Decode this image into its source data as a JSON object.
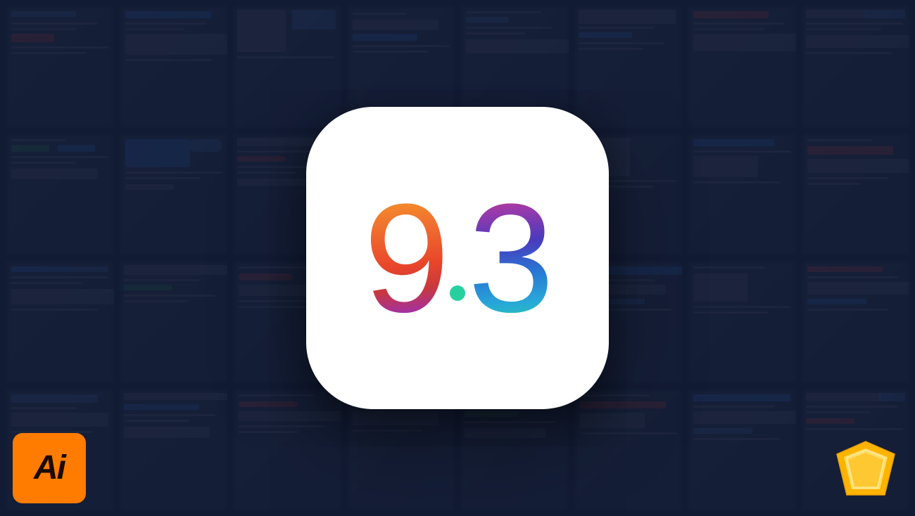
{
  "background": {
    "color": "#1a2340",
    "overlay_opacity": 0.62
  },
  "center_icon": {
    "version": "9.3",
    "version_nine": "9",
    "version_dot": ".",
    "version_three": "3",
    "border_radius": "95px",
    "bg_color": "#ffffff"
  },
  "ai_badge": {
    "label": "Ai",
    "bg_color": "#FF7C00",
    "text_color": "#1a0a00"
  },
  "sketch_badge": {
    "label": "Sketch"
  },
  "grid_cells": 32
}
